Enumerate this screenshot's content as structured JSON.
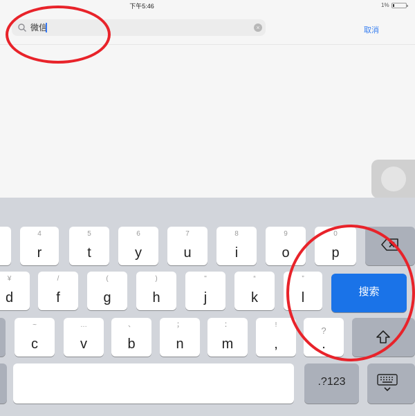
{
  "status_bar": {
    "time": "下午5:46",
    "battery": "1%"
  },
  "search": {
    "value": "微信",
    "cancel_label": "取消"
  },
  "keyboard": {
    "row1": [
      {
        "key": "r",
        "hint": "4"
      },
      {
        "key": "t",
        "hint": "5"
      },
      {
        "key": "y",
        "hint": "6"
      },
      {
        "key": "u",
        "hint": "7"
      },
      {
        "key": "i",
        "hint": "8"
      },
      {
        "key": "o",
        "hint": "9"
      },
      {
        "key": "p",
        "hint": "0"
      }
    ],
    "row2": [
      {
        "key": "d",
        "hint": "¥"
      },
      {
        "key": "f",
        "hint": "/"
      },
      {
        "key": "g",
        "hint": "("
      },
      {
        "key": "h",
        "hint": ")"
      },
      {
        "key": "j",
        "hint": "\""
      },
      {
        "key": "k",
        "hint": "“"
      },
      {
        "key": "l",
        "hint": "”"
      }
    ],
    "row3": [
      {
        "key": "c",
        "hint": "~"
      },
      {
        "key": "v",
        "hint": "…"
      },
      {
        "key": "b",
        "hint": "、"
      },
      {
        "key": "n",
        "hint": "；"
      },
      {
        "key": "m",
        "hint": "："
      },
      {
        "key": "!",
        "hint": ","
      },
      {
        "key": "?",
        "hint": "."
      }
    ],
    "search_key_label": "搜索",
    "numbers_key_label": ".?123"
  },
  "colors": {
    "search_key": "#1a73e8",
    "cancel_text": "#3a80f0",
    "annotation_circle": "#e8232a"
  }
}
